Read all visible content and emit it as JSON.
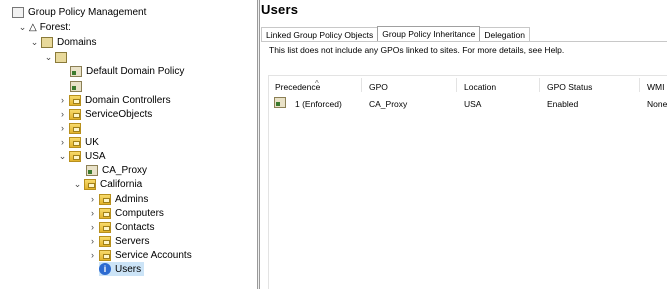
{
  "tree": {
    "root": "Group Policy Management",
    "forest": "Forest:",
    "domains": "Domains",
    "domain_name": "",
    "default_policy": "Default Domain Policy",
    "unnamed_ou": "",
    "items": {
      "domain_controllers": "Domain Controllers",
      "service_objects": "ServiceObjects",
      "blank_ou": "",
      "uk": "UK",
      "usa": "USA",
      "ca_proxy": "CA_Proxy",
      "california": "California",
      "admins": "Admins",
      "computers": "Computers",
      "contacts": "Contacts",
      "servers": "Servers",
      "service_accounts": "Service Accounts",
      "users": "Users"
    }
  },
  "panel": {
    "title": "Users",
    "tabs": [
      "Linked Group Policy Objects",
      "Group Policy Inheritance",
      "Delegation"
    ],
    "active_tab": "Group Policy Inheritance",
    "note": "This list does not include any GPOs linked to sites. For more details, see Help.",
    "columns": [
      "Precedence",
      "GPO",
      "Location",
      "GPO Status",
      "WMI"
    ],
    "rows": [
      {
        "precedence": "1 (Enforced)",
        "gpo": "CA_Proxy",
        "location": "USA",
        "status": "Enabled",
        "wmi": "None"
      }
    ]
  }
}
